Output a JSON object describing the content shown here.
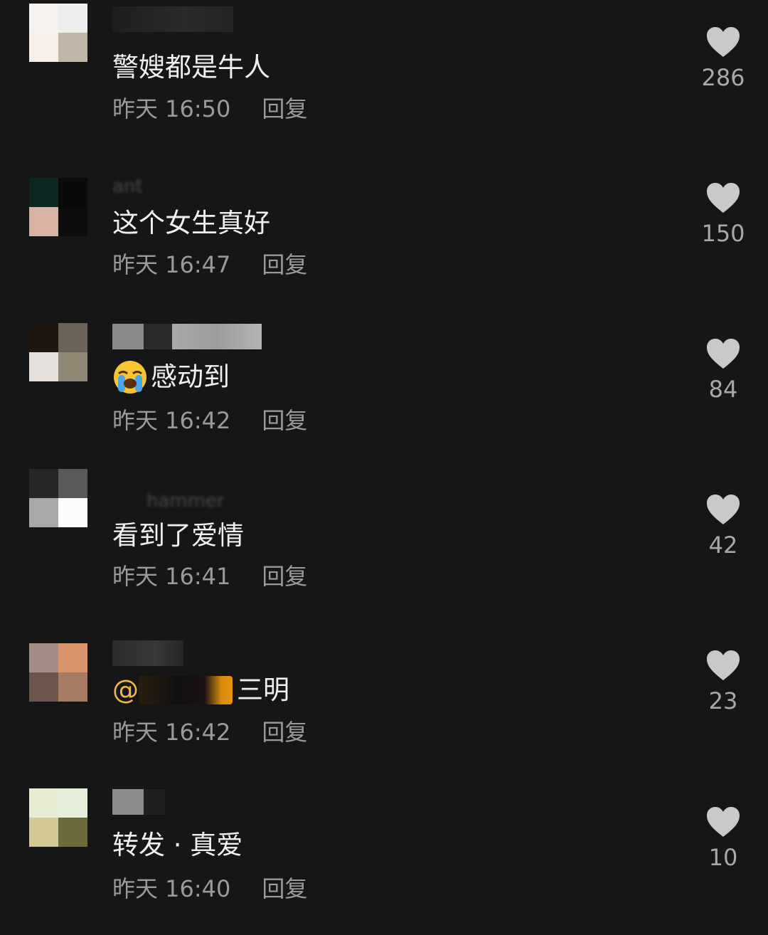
{
  "comments": [
    {
      "text": "警嫂都是牛人",
      "time": "昨天 16:50",
      "reply": "回复",
      "likes": "286"
    },
    {
      "text": "这个女生真好",
      "time": "昨天 16:47",
      "reply": "回复",
      "likes": "150"
    },
    {
      "text": "感动到",
      "emoji": "loudly-crying-face-icon",
      "time": "昨天 16:42",
      "reply": "回复",
      "likes": "84"
    },
    {
      "text": "看到了爱情",
      "time": "昨天 16:41",
      "reply": "回复",
      "likes": "42"
    },
    {
      "mention": "@",
      "text": "三明",
      "time": "昨天 16:42",
      "reply": "回复",
      "likes": "23"
    },
    {
      "text": "转发 · 真爱",
      "time": "昨天 16:40",
      "reply": "回复",
      "likes": "10"
    }
  ],
  "colors": {
    "background": "#161616",
    "text": "#f0f0f0",
    "meta": "#9a9a9a",
    "like_icon": "#c9c9c9",
    "mention": "#f0b74a"
  },
  "icons": {
    "like": "heart-icon"
  }
}
